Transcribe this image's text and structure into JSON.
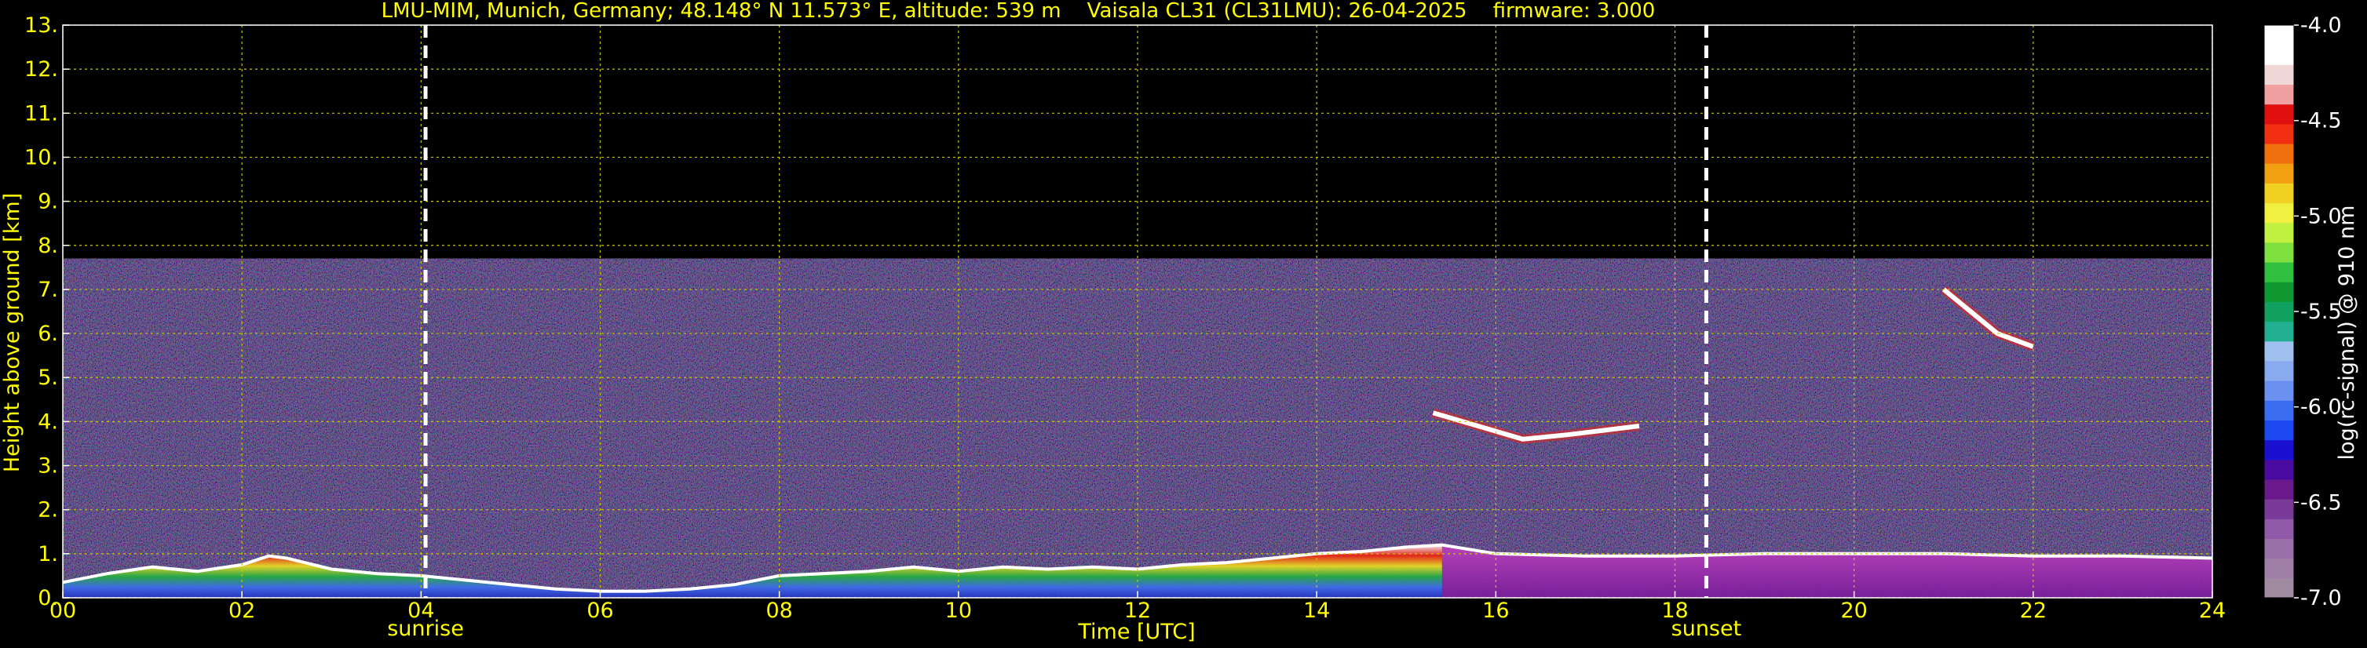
{
  "chart_data": {
    "type": "heatmap",
    "title": "LMU-MIM, Munich, Germany; 48.148° N 11.573° E, altitude: 539 m    Vaisala CL31 (CL31LMU): 26-04-2025    firmware: 3.000",
    "xlabel": "Time [UTC]",
    "ylabel": "Height above ground [km]",
    "xlim": [
      0,
      24
    ],
    "ylim": [
      0,
      13
    ],
    "x_ticks": [
      {
        "v": 0,
        "label": "00"
      },
      {
        "v": 2,
        "label": "02"
      },
      {
        "v": 4,
        "label": "04"
      },
      {
        "v": 6,
        "label": "06"
      },
      {
        "v": 8,
        "label": "08"
      },
      {
        "v": 10,
        "label": "10"
      },
      {
        "v": 12,
        "label": "12"
      },
      {
        "v": 14,
        "label": "14"
      },
      {
        "v": 16,
        "label": "16"
      },
      {
        "v": 18,
        "label": "18"
      },
      {
        "v": 20,
        "label": "20"
      },
      {
        "v": 22,
        "label": "22"
      },
      {
        "v": 24,
        "label": "24"
      }
    ],
    "y_ticks": [
      {
        "v": 0,
        "label": "0."
      },
      {
        "v": 1,
        "label": "1."
      },
      {
        "v": 2,
        "label": "2."
      },
      {
        "v": 3,
        "label": "3."
      },
      {
        "v": 4,
        "label": "4."
      },
      {
        "v": 5,
        "label": "5."
      },
      {
        "v": 6,
        "label": "6."
      },
      {
        "v": 7,
        "label": "7."
      },
      {
        "v": 8,
        "label": "8."
      },
      {
        "v": 9,
        "label": "9."
      },
      {
        "v": 10,
        "label": "10."
      },
      {
        "v": 11,
        "label": "11."
      },
      {
        "v": 12,
        "label": "12."
      },
      {
        "v": 13,
        "label": "13."
      }
    ],
    "grid": true,
    "measurement_top_km": 7.7,
    "markers": [
      {
        "x": 4.05,
        "label": "sunrise"
      },
      {
        "x": 18.35,
        "label": "sunset"
      }
    ],
    "colorbar": {
      "label": "log(rc-signal) @ 910 nm",
      "range": [
        -7.0,
        -4.0
      ],
      "ticks": [
        {
          "v": -4.0,
          "label": "-4.0"
        },
        {
          "v": -4.5,
          "label": "-4.5"
        },
        {
          "v": -5.0,
          "label": "-5.0"
        },
        {
          "v": -5.5,
          "label": "-5.5"
        },
        {
          "v": -6.0,
          "label": "-6.0"
        },
        {
          "v": -6.5,
          "label": "-6.5"
        },
        {
          "v": -7.0,
          "label": "-7.0"
        }
      ],
      "colors_bottom_to_top": [
        "#a08aa0",
        "#a07fa6",
        "#9a70a8",
        "#905aa8",
        "#7a3a98",
        "#6a1a8a",
        "#4a0aa0",
        "#1a10d0",
        "#1e48f0",
        "#3c6cf0",
        "#6a90f0",
        "#8aaaf0",
        "#a0c0f0",
        "#20b090",
        "#10a060",
        "#109830",
        "#30c040",
        "#80e040",
        "#c0f040",
        "#f0f040",
        "#f0d020",
        "#f0a010",
        "#f07010",
        "#f03010",
        "#e01010",
        "#f0a0a0",
        "#f0d8d8",
        "#ffffff",
        "#ffffff"
      ]
    },
    "colors": {
      "text": "#ffff00",
      "grid": "#c8c800",
      "marker": "#ffffff",
      "background": "#000000"
    },
    "series": [
      {
        "kind": "boundary-layer top",
        "x": [
          0,
          0.5,
          1,
          1.5,
          2,
          2.3,
          2.5,
          3,
          3.5,
          4,
          4.5,
          5,
          5.5,
          6,
          6.5,
          7,
          7.5,
          8,
          8.5,
          9,
          9.5,
          10,
          10.5,
          11,
          11.5,
          12,
          12.5,
          13,
          13.5,
          14,
          14.5,
          15,
          15.4,
          16,
          17,
          18,
          19,
          20,
          21,
          22,
          23,
          24
        ],
        "y": [
          0.35,
          0.55,
          0.7,
          0.6,
          0.75,
          0.95,
          0.9,
          0.65,
          0.55,
          0.5,
          0.4,
          0.3,
          0.2,
          0.15,
          0.15,
          0.2,
          0.3,
          0.5,
          0.55,
          0.6,
          0.7,
          0.6,
          0.7,
          0.65,
          0.7,
          0.65,
          0.75,
          0.8,
          0.9,
          1.0,
          1.05,
          1.15,
          1.2,
          1.0,
          0.95,
          0.95,
          1.0,
          1.0,
          1.0,
          0.95,
          0.95,
          0.9
        ]
      },
      {
        "kind": "cloud layer",
        "x": [
          15.3,
          15.8,
          16.3,
          16.8,
          17.2,
          17.6
        ],
        "y": [
          4.2,
          3.9,
          3.6,
          3.7,
          3.8,
          3.9
        ]
      },
      {
        "kind": "cloud layer",
        "x": [
          21.0,
          21.3,
          21.6,
          22.0
        ],
        "y": [
          7.0,
          6.5,
          6.0,
          5.7
        ]
      }
    ]
  }
}
